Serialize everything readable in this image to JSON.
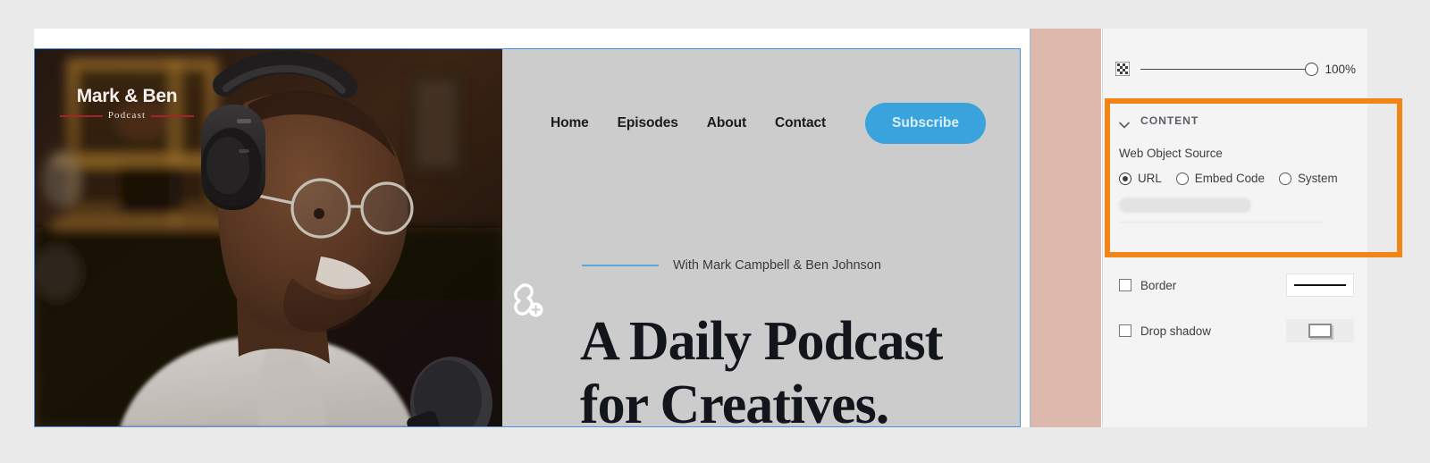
{
  "website_preview": {
    "logo": {
      "brand": "Mark & Ben",
      "subtitle": "Podcast"
    },
    "nav": [
      {
        "label": "Home"
      },
      {
        "label": "Episodes"
      },
      {
        "label": "About"
      },
      {
        "label": "Contact"
      }
    ],
    "cta": {
      "label": "Subscribe",
      "color": "#3aa3dc"
    },
    "hero": {
      "kicker": "With Mark Campbell & Ben Johnson",
      "title_line1": "A Daily Podcast",
      "title_line2": "for Creatives."
    },
    "link_badge_icon": "link-add-icon",
    "selection_color": "#4a90e2"
  },
  "panel": {
    "opacity": {
      "icon": "checkerboard-icon",
      "value": "100%"
    },
    "content_section": {
      "chevron_icon": "chevron-down-icon",
      "title": "CONTENT",
      "field_label": "Web Object Source",
      "source_options": [
        {
          "label": "URL",
          "selected": true
        },
        {
          "label": "Embed Code",
          "selected": false
        },
        {
          "label": "System",
          "selected": false
        }
      ],
      "url_value": "",
      "url_placeholder": ""
    },
    "options": [
      {
        "label": "Border",
        "checked": false,
        "swatch": "line-style-swatch"
      },
      {
        "label": "Drop shadow",
        "checked": false,
        "swatch": "drop-shadow-swatch"
      }
    ],
    "highlight_color": "#f28518"
  }
}
